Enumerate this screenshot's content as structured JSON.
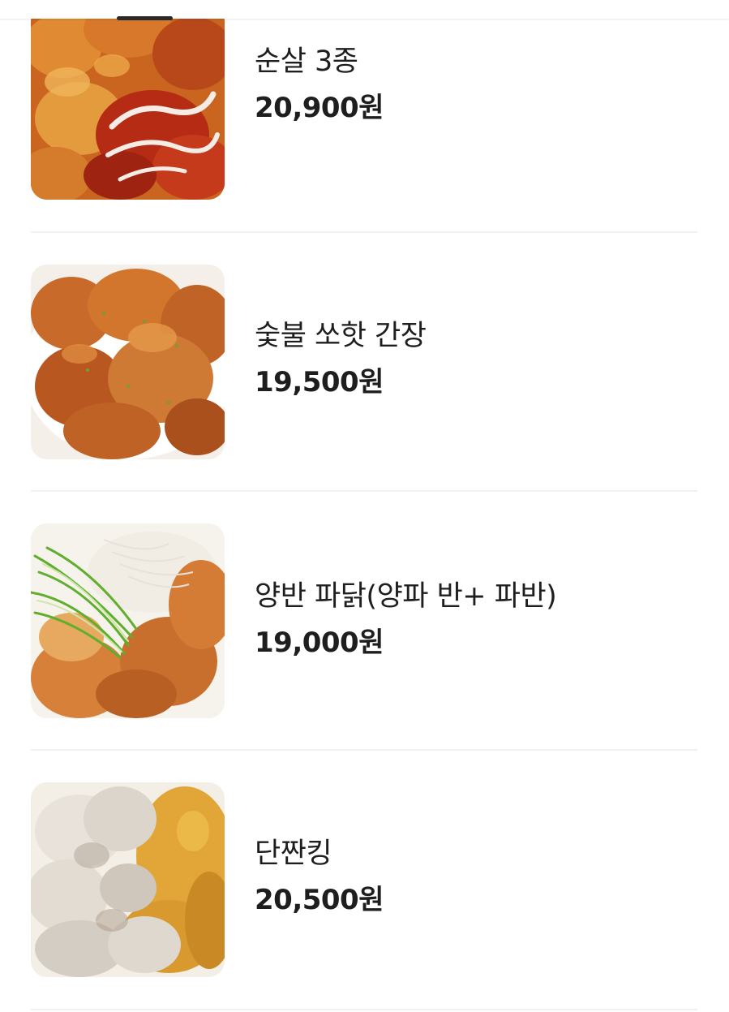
{
  "menu": {
    "items": [
      {
        "name": "순살 3종",
        "price": "20,900원",
        "image": "boneless-chicken-three-flavors-photo"
      },
      {
        "name": "숯불 쏘핫 간장",
        "price": "19,500원",
        "image": "charcoal-hot-soy-chicken-photo"
      },
      {
        "name": "양반 파닭(양파 반+ 파반)",
        "price": "19,000원",
        "image": "green-onion-chicken-photo"
      },
      {
        "name": "단짠킹",
        "price": "20,500원",
        "image": "sweet-salty-chicken-photo"
      }
    ]
  },
  "colors": {
    "text": "#1e1e1e",
    "divider": "#f1f1f1",
    "background": "#ffffff"
  }
}
